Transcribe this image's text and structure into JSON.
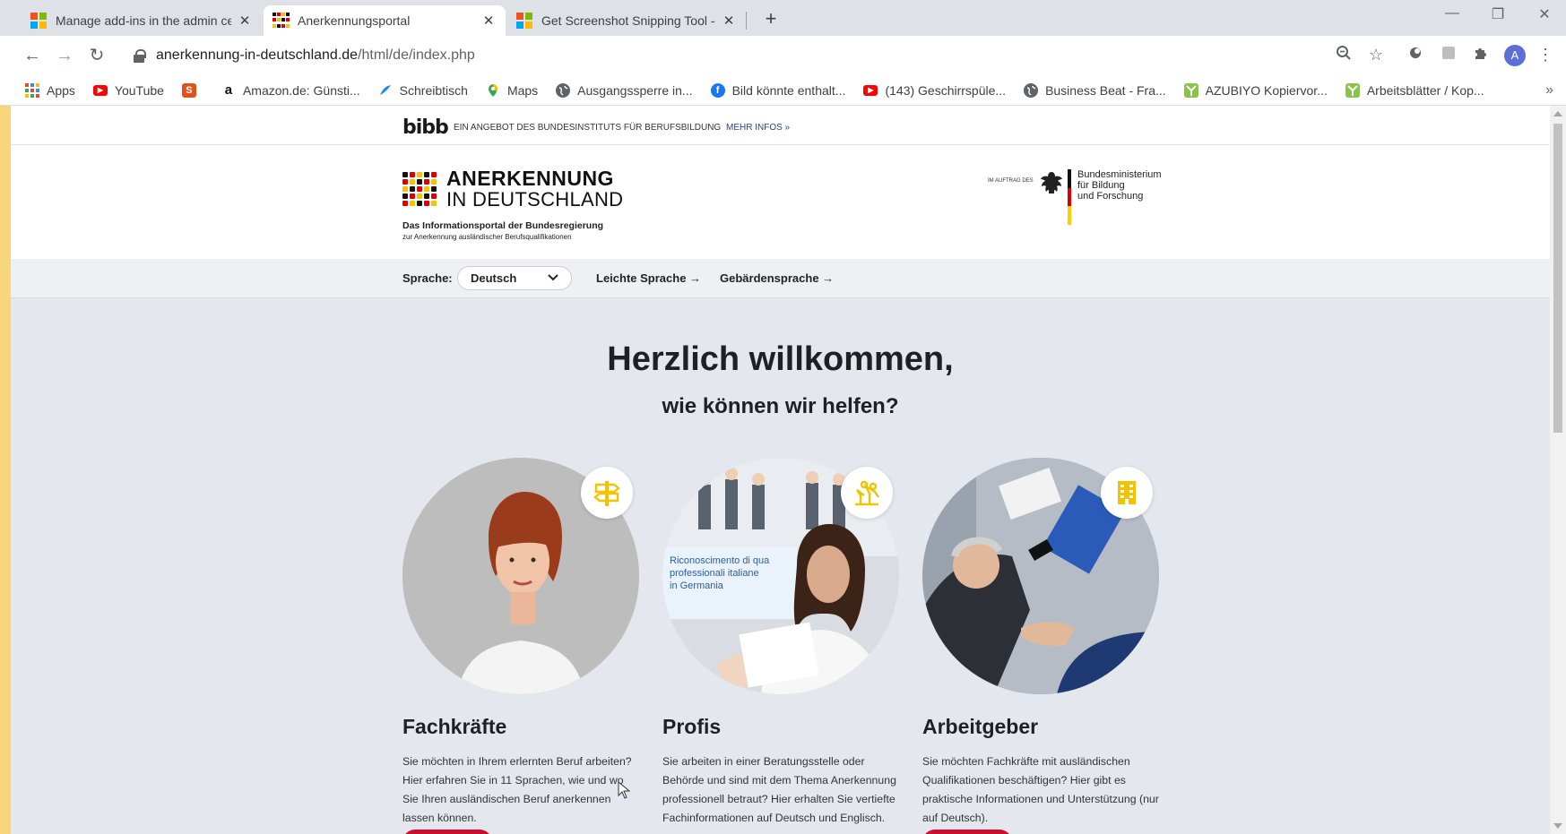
{
  "tabs": [
    {
      "title": "Manage add-ins in the admin cen",
      "close": "✕",
      "icon": "microsoft-logo"
    },
    {
      "title": "Anerkennungsportal",
      "close": "✕",
      "icon": "anerkennung-logo"
    },
    {
      "title": "Get Screenshot Snipping Tool - M",
      "close": "✕",
      "icon": "microsoft-logo"
    }
  ],
  "new_tab": "+",
  "window_controls": {
    "minimize": "—",
    "restore": "❐",
    "close": "✕"
  },
  "toolbar": {
    "back": "←",
    "forward": "→",
    "reload": "↻",
    "url_host": "anerkennung-in-deutschland.de",
    "url_path": "/html/de/index.php",
    "avatar": "A"
  },
  "bookmarks": [
    {
      "label": "Apps",
      "icon": "apps-icon"
    },
    {
      "label": "YouTube",
      "icon": "youtube-icon"
    },
    {
      "label": "",
      "icon": "s-icon",
      "glyph": "S"
    },
    {
      "label": "Amazon.de: Günsti...",
      "icon": "amazon-icon",
      "glyph": "a"
    },
    {
      "label": "Schreibtisch",
      "icon": "desk-icon"
    },
    {
      "label": "Maps",
      "icon": "maps-icon"
    },
    {
      "label": "Ausgangssperre in...",
      "icon": "globe-icon"
    },
    {
      "label": "Bild könnte enthalt...",
      "icon": "facebook-icon",
      "glyph": "f"
    },
    {
      "label": "(143) Geschirrspüle...",
      "icon": "youtube-icon"
    },
    {
      "label": "Business Beat - Fra...",
      "icon": "globe-icon"
    },
    {
      "label": "AZUBIYO Kopiervor...",
      "icon": "azubiyo-icon"
    },
    {
      "label": "Arbeitsblätter / Kop...",
      "icon": "azubiyo-icon"
    }
  ],
  "bookmarks_more": "»",
  "site": {
    "bibb_logo": "bibb",
    "bibb_text": "EIN ANGEBOT DES BUNDESINSTITUTS FÜR BERUFSBILDUNG",
    "bibb_more": "MEHR INFOS  »",
    "brand_line1": "ANERKENNUNG",
    "brand_line2": "IN DEUTSCHLAND",
    "tagline1": "Das Informationsportal der Bundesregierung",
    "tagline2": "zur Anerkennung ausländischer Berufsqualifikationen",
    "bmbf_prefix": "IM AUFTRAG DES",
    "bmbf_name": "Bundesministerium\nfür Bildung\nund Forschung",
    "lang_label": "Sprache:",
    "lang_value": "Deutsch",
    "link_easy": "Leichte Sprache →",
    "link_sign": "Gebärdensprache →",
    "hero_title": "Herzlich willkommen,",
    "hero_sub": "wie können wir helfen?",
    "cards": [
      {
        "title": "Fachkräfte",
        "text": "Sie möchten in Ihrem erlernten Beruf arbeiten? Hier erfahren Sie in 11 Sprachen, wie und wo Sie Ihren ausländischen Beruf anerkennen lassen können.",
        "icon": "signpost-icon"
      },
      {
        "title": "Profis",
        "text": "Sie arbeiten in einer Beratungsstelle oder Behörde und sind mit dem Thema Anerkennung professionell betraut? Hier erhalten Sie vertiefte Fachinformationen auf Deutsch und Englisch.",
        "icon": "people-icon"
      },
      {
        "title": "Arbeitgeber",
        "text": "Sie möchten Fachkräfte mit ausländischen Qualifikationen beschäftigen? Hier gibt es praktische Informationen und Unterstützung (nur auf Deutsch).",
        "icon": "building-icon"
      }
    ],
    "photo_poster_text": "Riconoscimento di qua\nprofessionali italiane\nin Germania"
  },
  "colors": {
    "accent_red": "#c8102e",
    "badge_yellow": "#f2c300",
    "page_bg": "#e4e7ee"
  }
}
